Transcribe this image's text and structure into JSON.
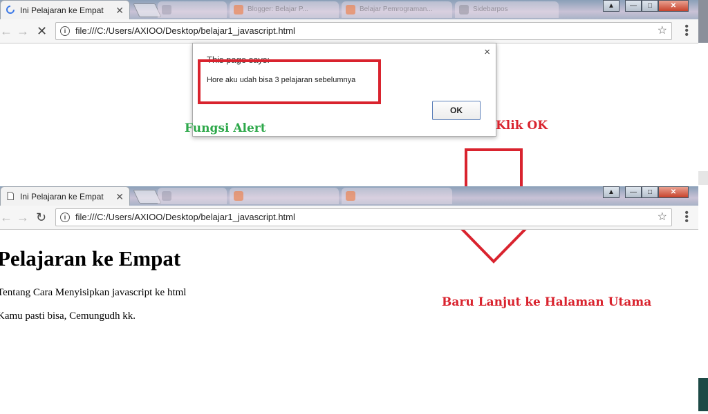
{
  "top_browser": {
    "tab_title": "Ini Pelajaran ke Empat",
    "background_tabs": [
      "",
      "Blogger: Belajar P...",
      "Belajar Pemrograman...",
      "Sidebarpos"
    ],
    "url": "file:///C:/Users/AXIOO/Desktop/belajar1_javascript.html"
  },
  "alert_dialog": {
    "title": "This page says:",
    "message": "Hore aku udah bisa 3 pelajaran sebelumnya",
    "ok_label": "OK",
    "close_glyph": "×"
  },
  "annotations": {
    "alert_label": "Fungsi Alert",
    "click_ok_label": "Klik OK",
    "continue_label": "Baru Lanjut ke Halaman Utama",
    "colors": {
      "green": "#2da84a",
      "red": "#d9232e"
    }
  },
  "bottom_browser": {
    "tab_title": "Ini Pelajaran ke Empat",
    "url": "file:///C:/Users/AXIOO/Desktop/belajar1_javascript.html"
  },
  "page_content": {
    "heading": "Pelajaran ke Empat",
    "paragraph_1": "Tentang Cara Menyisipkan javascript ke html",
    "paragraph_2": "Kamu pasti bisa, Cemungudh kk."
  },
  "icons": [
    "back-icon",
    "forward-icon",
    "stop-icon",
    "reload-icon",
    "info-icon",
    "star-icon",
    "menu-icon",
    "close-icon",
    "loading-icon",
    "page-icon"
  ]
}
